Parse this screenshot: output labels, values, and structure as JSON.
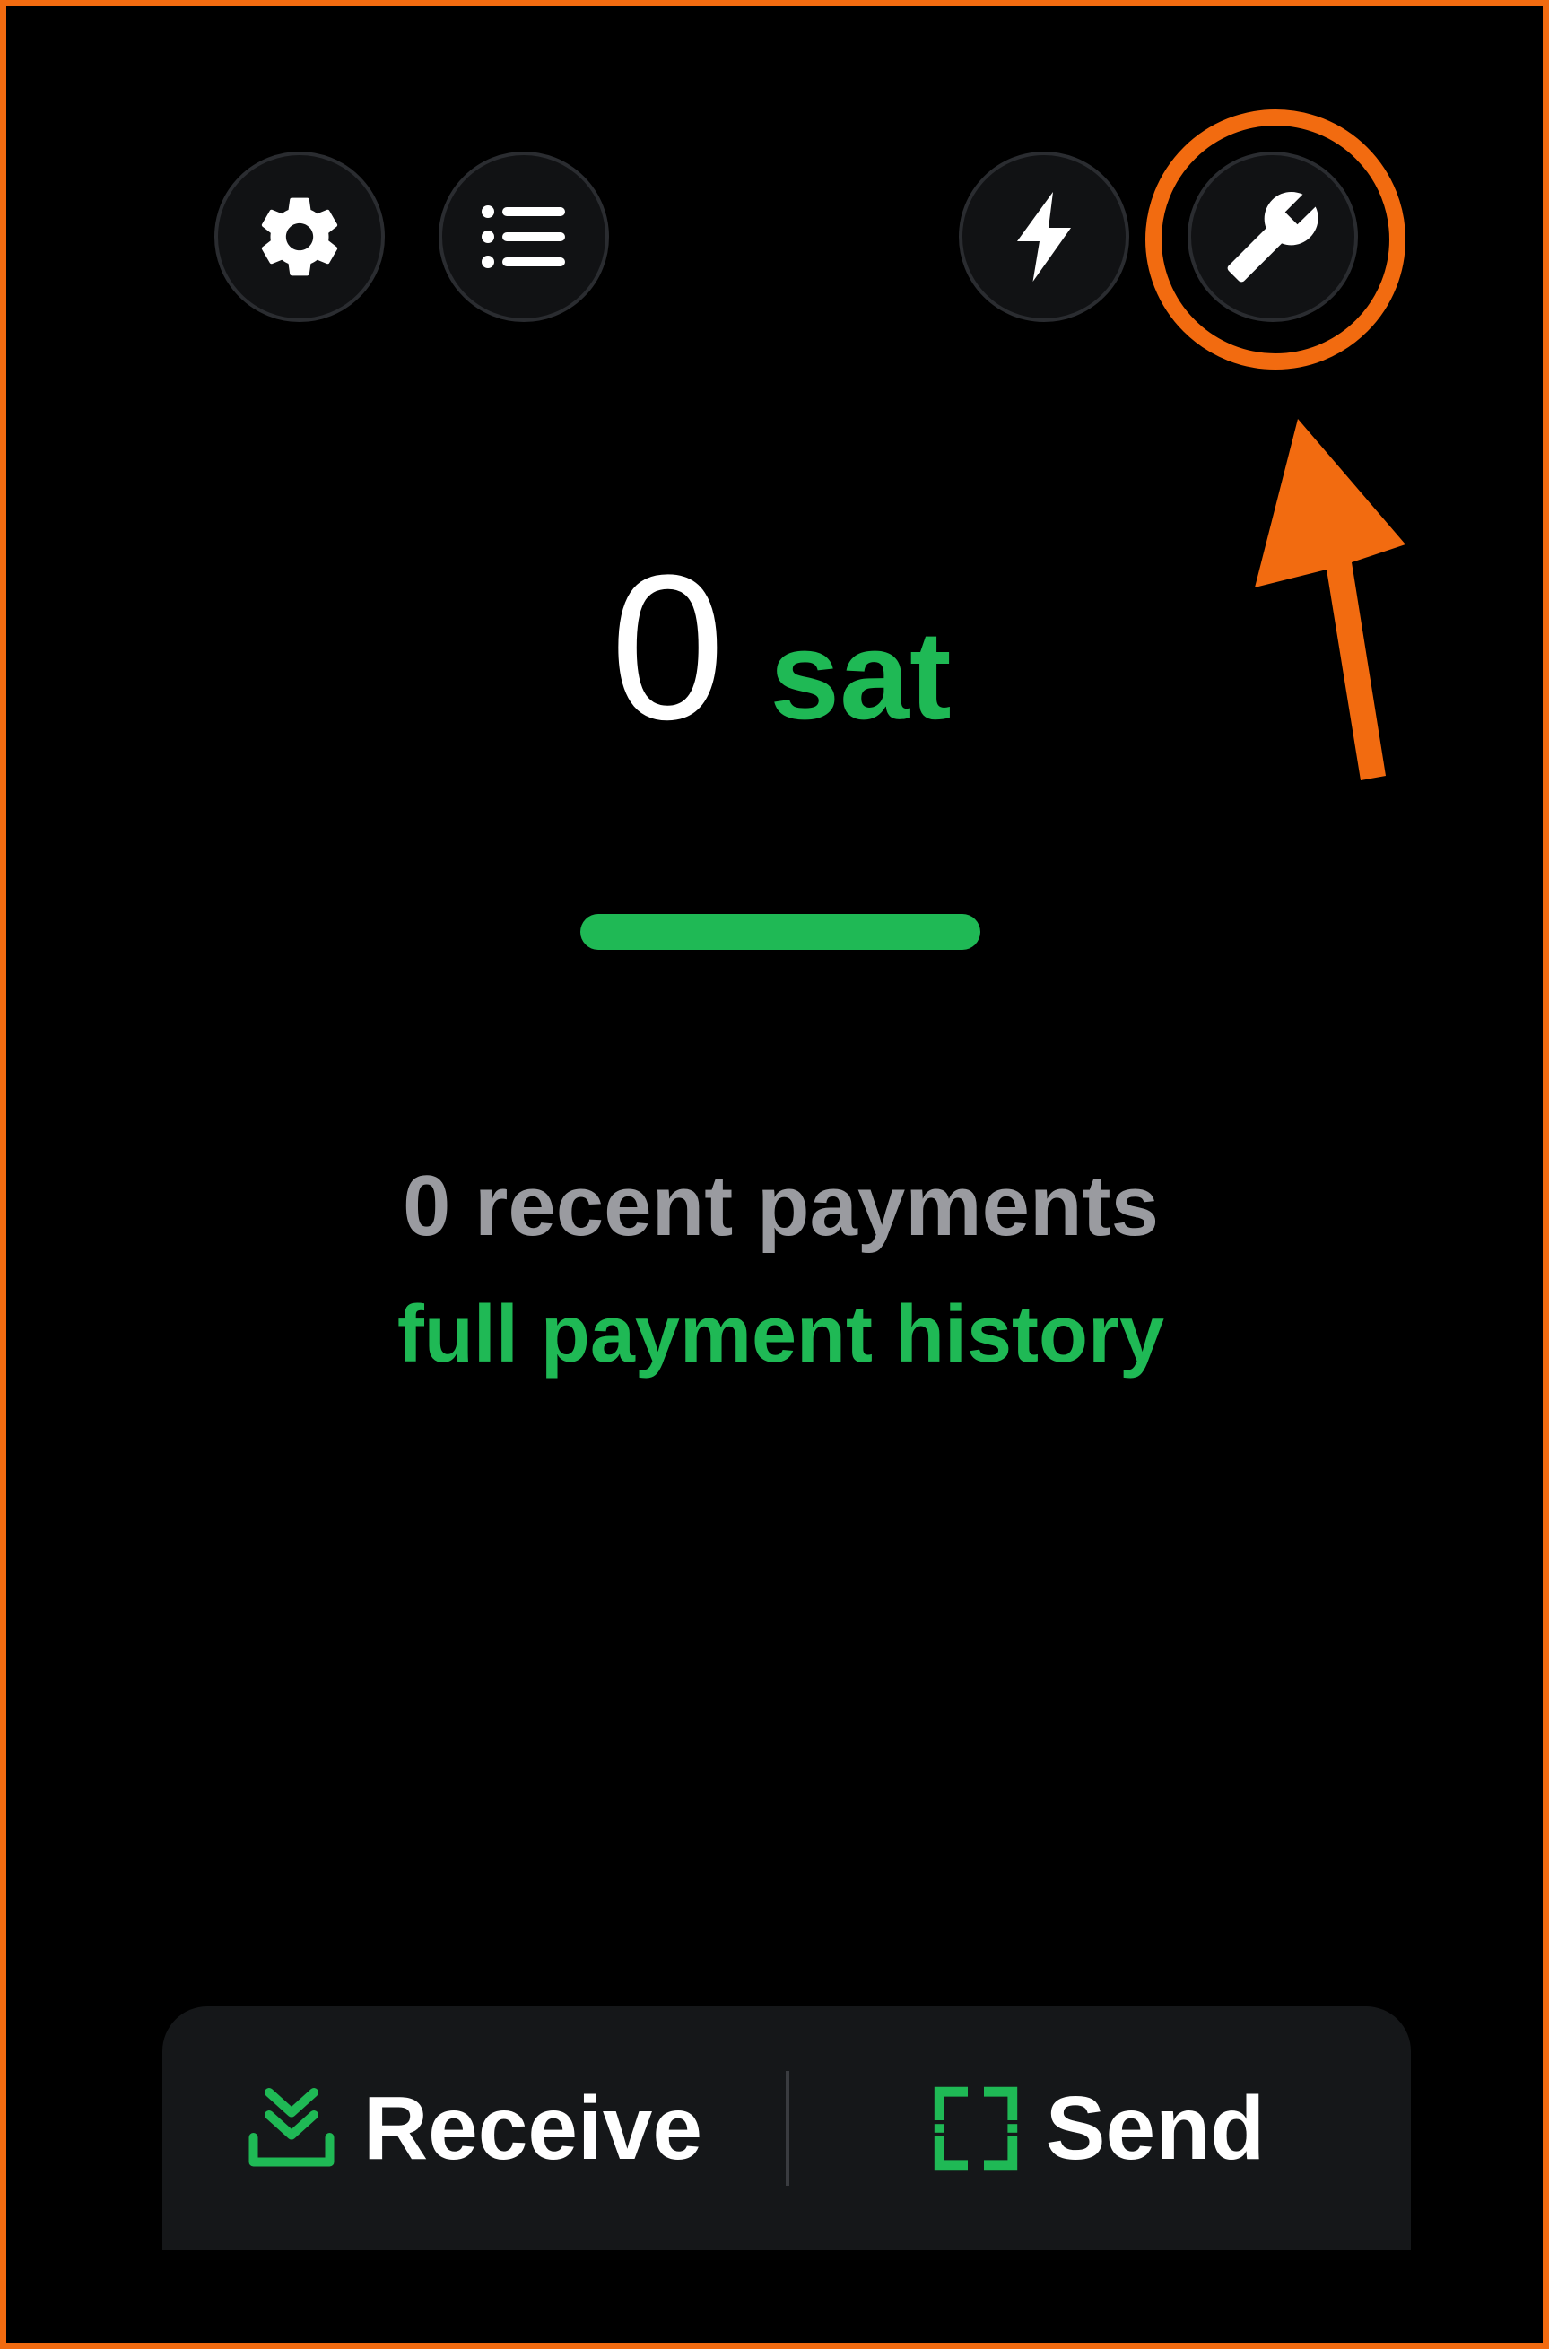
{
  "balance": {
    "amount": "0",
    "unit": "sat"
  },
  "payments": {
    "recent_count_label": "0 recent payments",
    "history_link": "full payment history"
  },
  "actions": {
    "receive_label": "Receive",
    "send_label": "Send"
  },
  "toolbar": {
    "icons": [
      "gear-icon",
      "list-icon",
      "lightning-icon",
      "wrench-icon"
    ]
  },
  "colors": {
    "accent_green": "#1fb955",
    "highlight_orange": "#f26b10",
    "background": "#000000",
    "muted_text": "#9a9ba0"
  }
}
